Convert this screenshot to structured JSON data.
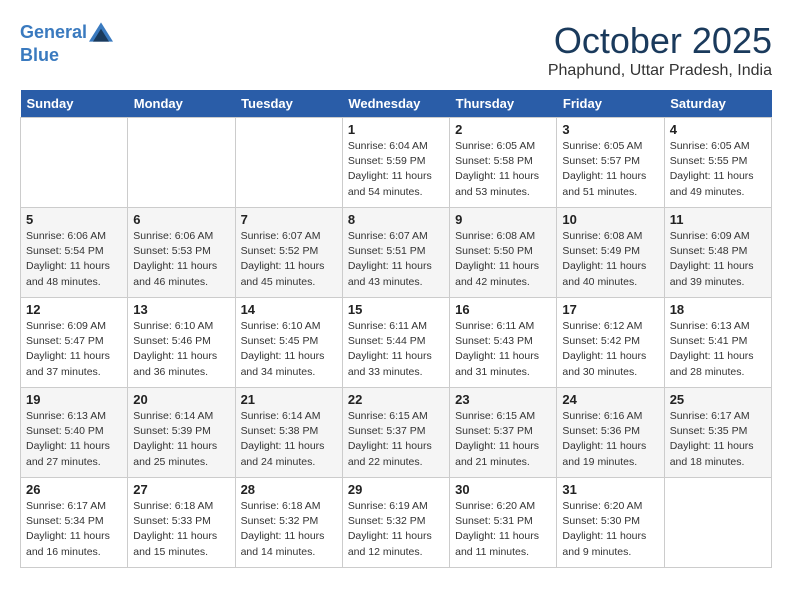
{
  "header": {
    "logo_line1": "General",
    "logo_line2": "Blue",
    "month_title": "October 2025",
    "location": "Phaphund, Uttar Pradesh, India"
  },
  "weekdays": [
    "Sunday",
    "Monday",
    "Tuesday",
    "Wednesday",
    "Thursday",
    "Friday",
    "Saturday"
  ],
  "weeks": [
    [
      {
        "day": "",
        "info": ""
      },
      {
        "day": "",
        "info": ""
      },
      {
        "day": "",
        "info": ""
      },
      {
        "day": "1",
        "info": "Sunrise: 6:04 AM\nSunset: 5:59 PM\nDaylight: 11 hours\nand 54 minutes."
      },
      {
        "day": "2",
        "info": "Sunrise: 6:05 AM\nSunset: 5:58 PM\nDaylight: 11 hours\nand 53 minutes."
      },
      {
        "day": "3",
        "info": "Sunrise: 6:05 AM\nSunset: 5:57 PM\nDaylight: 11 hours\nand 51 minutes."
      },
      {
        "day": "4",
        "info": "Sunrise: 6:05 AM\nSunset: 5:55 PM\nDaylight: 11 hours\nand 49 minutes."
      }
    ],
    [
      {
        "day": "5",
        "info": "Sunrise: 6:06 AM\nSunset: 5:54 PM\nDaylight: 11 hours\nand 48 minutes."
      },
      {
        "day": "6",
        "info": "Sunrise: 6:06 AM\nSunset: 5:53 PM\nDaylight: 11 hours\nand 46 minutes."
      },
      {
        "day": "7",
        "info": "Sunrise: 6:07 AM\nSunset: 5:52 PM\nDaylight: 11 hours\nand 45 minutes."
      },
      {
        "day": "8",
        "info": "Sunrise: 6:07 AM\nSunset: 5:51 PM\nDaylight: 11 hours\nand 43 minutes."
      },
      {
        "day": "9",
        "info": "Sunrise: 6:08 AM\nSunset: 5:50 PM\nDaylight: 11 hours\nand 42 minutes."
      },
      {
        "day": "10",
        "info": "Sunrise: 6:08 AM\nSunset: 5:49 PM\nDaylight: 11 hours\nand 40 minutes."
      },
      {
        "day": "11",
        "info": "Sunrise: 6:09 AM\nSunset: 5:48 PM\nDaylight: 11 hours\nand 39 minutes."
      }
    ],
    [
      {
        "day": "12",
        "info": "Sunrise: 6:09 AM\nSunset: 5:47 PM\nDaylight: 11 hours\nand 37 minutes."
      },
      {
        "day": "13",
        "info": "Sunrise: 6:10 AM\nSunset: 5:46 PM\nDaylight: 11 hours\nand 36 minutes."
      },
      {
        "day": "14",
        "info": "Sunrise: 6:10 AM\nSunset: 5:45 PM\nDaylight: 11 hours\nand 34 minutes."
      },
      {
        "day": "15",
        "info": "Sunrise: 6:11 AM\nSunset: 5:44 PM\nDaylight: 11 hours\nand 33 minutes."
      },
      {
        "day": "16",
        "info": "Sunrise: 6:11 AM\nSunset: 5:43 PM\nDaylight: 11 hours\nand 31 minutes."
      },
      {
        "day": "17",
        "info": "Sunrise: 6:12 AM\nSunset: 5:42 PM\nDaylight: 11 hours\nand 30 minutes."
      },
      {
        "day": "18",
        "info": "Sunrise: 6:13 AM\nSunset: 5:41 PM\nDaylight: 11 hours\nand 28 minutes."
      }
    ],
    [
      {
        "day": "19",
        "info": "Sunrise: 6:13 AM\nSunset: 5:40 PM\nDaylight: 11 hours\nand 27 minutes."
      },
      {
        "day": "20",
        "info": "Sunrise: 6:14 AM\nSunset: 5:39 PM\nDaylight: 11 hours\nand 25 minutes."
      },
      {
        "day": "21",
        "info": "Sunrise: 6:14 AM\nSunset: 5:38 PM\nDaylight: 11 hours\nand 24 minutes."
      },
      {
        "day": "22",
        "info": "Sunrise: 6:15 AM\nSunset: 5:37 PM\nDaylight: 11 hours\nand 22 minutes."
      },
      {
        "day": "23",
        "info": "Sunrise: 6:15 AM\nSunset: 5:37 PM\nDaylight: 11 hours\nand 21 minutes."
      },
      {
        "day": "24",
        "info": "Sunrise: 6:16 AM\nSunset: 5:36 PM\nDaylight: 11 hours\nand 19 minutes."
      },
      {
        "day": "25",
        "info": "Sunrise: 6:17 AM\nSunset: 5:35 PM\nDaylight: 11 hours\nand 18 minutes."
      }
    ],
    [
      {
        "day": "26",
        "info": "Sunrise: 6:17 AM\nSunset: 5:34 PM\nDaylight: 11 hours\nand 16 minutes."
      },
      {
        "day": "27",
        "info": "Sunrise: 6:18 AM\nSunset: 5:33 PM\nDaylight: 11 hours\nand 15 minutes."
      },
      {
        "day": "28",
        "info": "Sunrise: 6:18 AM\nSunset: 5:32 PM\nDaylight: 11 hours\nand 14 minutes."
      },
      {
        "day": "29",
        "info": "Sunrise: 6:19 AM\nSunset: 5:32 PM\nDaylight: 11 hours\nand 12 minutes."
      },
      {
        "day": "30",
        "info": "Sunrise: 6:20 AM\nSunset: 5:31 PM\nDaylight: 11 hours\nand 11 minutes."
      },
      {
        "day": "31",
        "info": "Sunrise: 6:20 AM\nSunset: 5:30 PM\nDaylight: 11 hours\nand 9 minutes."
      },
      {
        "day": "",
        "info": ""
      }
    ]
  ]
}
